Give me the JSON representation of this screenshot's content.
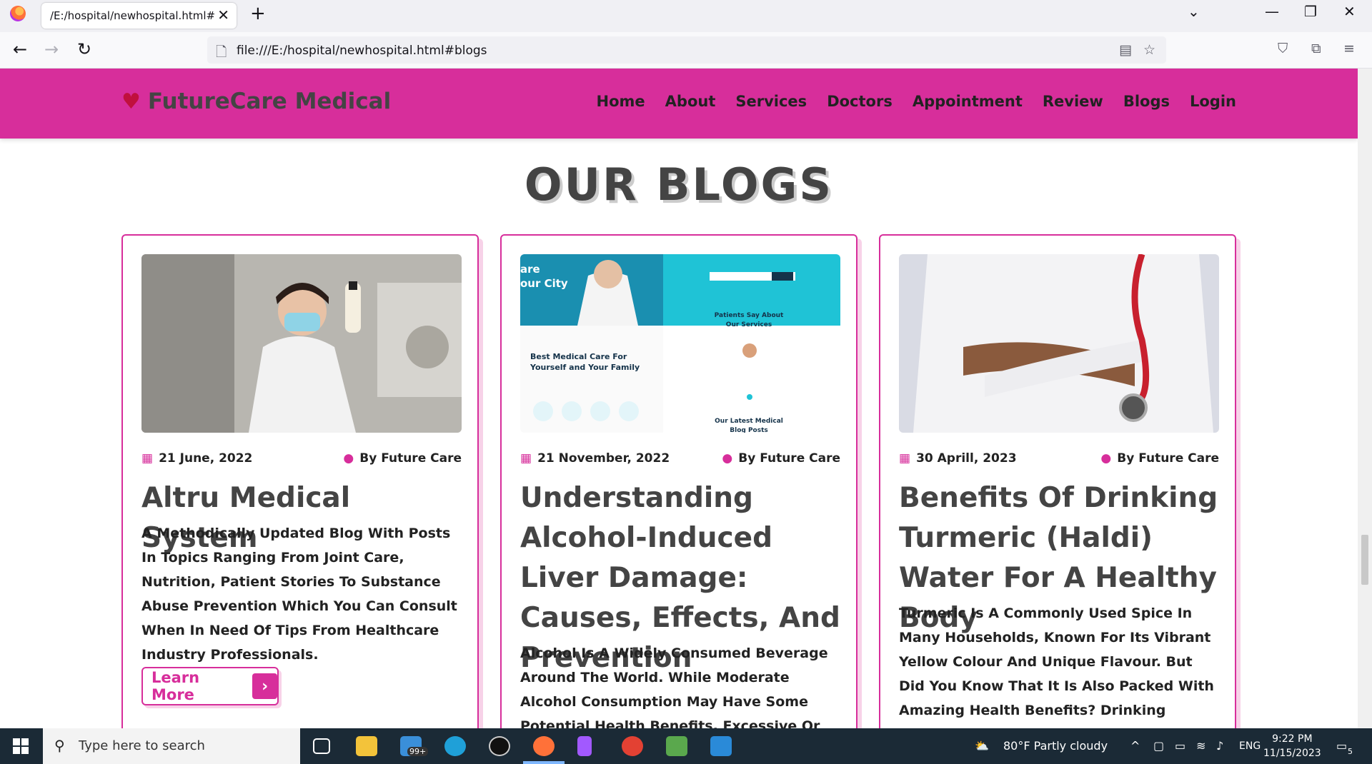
{
  "browser": {
    "tab_title": "/E:/hospital/newhospital.html#about",
    "url": "file:///E:/hospital/newhospital.html#blogs"
  },
  "site": {
    "logo": "FutureCare Medical",
    "menu": [
      "Home",
      "About",
      "Services",
      "Doctors",
      "Appointment",
      "Review",
      "Blogs",
      "Login"
    ]
  },
  "section": {
    "heading": "OUR BLOGS"
  },
  "blogs": [
    {
      "date": "21 June, 2022",
      "author": "By Future Care",
      "title": "Altru Medical System",
      "desc": "A Methodically Updated Blog With Posts In Topics Ranging From Joint Care, Nutrition, Patient Stories To Substance Abuse Prevention Which You Can Consult When In Need Of Tips From Healthcare Industry Professionals.",
      "button": "Learn More"
    },
    {
      "date": "21 November, 2022",
      "author": "By Future Care",
      "title": "Understanding Alcohol-Induced Liver Damage: Causes, Effects, And Prevention",
      "desc": "Alcohol Is A Widely Consumed Beverage Around The World. While Moderate Alcohol Consumption May Have Some Potential Health Benefits, Excessive Or Long-Term",
      "thumb": {
        "text1": "are",
        "text2": "our City",
        "title": "Best Medical Care For Yourself and Your Family",
        "testimonials": "Patients Say About Our Services",
        "latest": "Our Latest Medical Blog Posts"
      }
    },
    {
      "date": "30 Aprill, 2023",
      "author": "By Future Care",
      "title": "Benefits Of Drinking Turmeric (Haldi) Water For A Healthy Body",
      "desc": "Turmeric Is A Commonly Used Spice In Many Households, Known For Its Vibrant Yellow Colour And Unique Flavour. But Did You Know That It Is Also Packed With Amazing Health Benefits? Drinking Turmeric Water Has"
    }
  ],
  "taskbar": {
    "search_placeholder": "Type here to search",
    "mail_badge": "99+",
    "weather": "80°F  Partly cloudy",
    "lang": "ENG",
    "time": "9:22 PM",
    "date": "11/15/2023",
    "notif_count": "5"
  },
  "colors": {
    "brand": "#d72e9b",
    "heading": "#444444"
  }
}
